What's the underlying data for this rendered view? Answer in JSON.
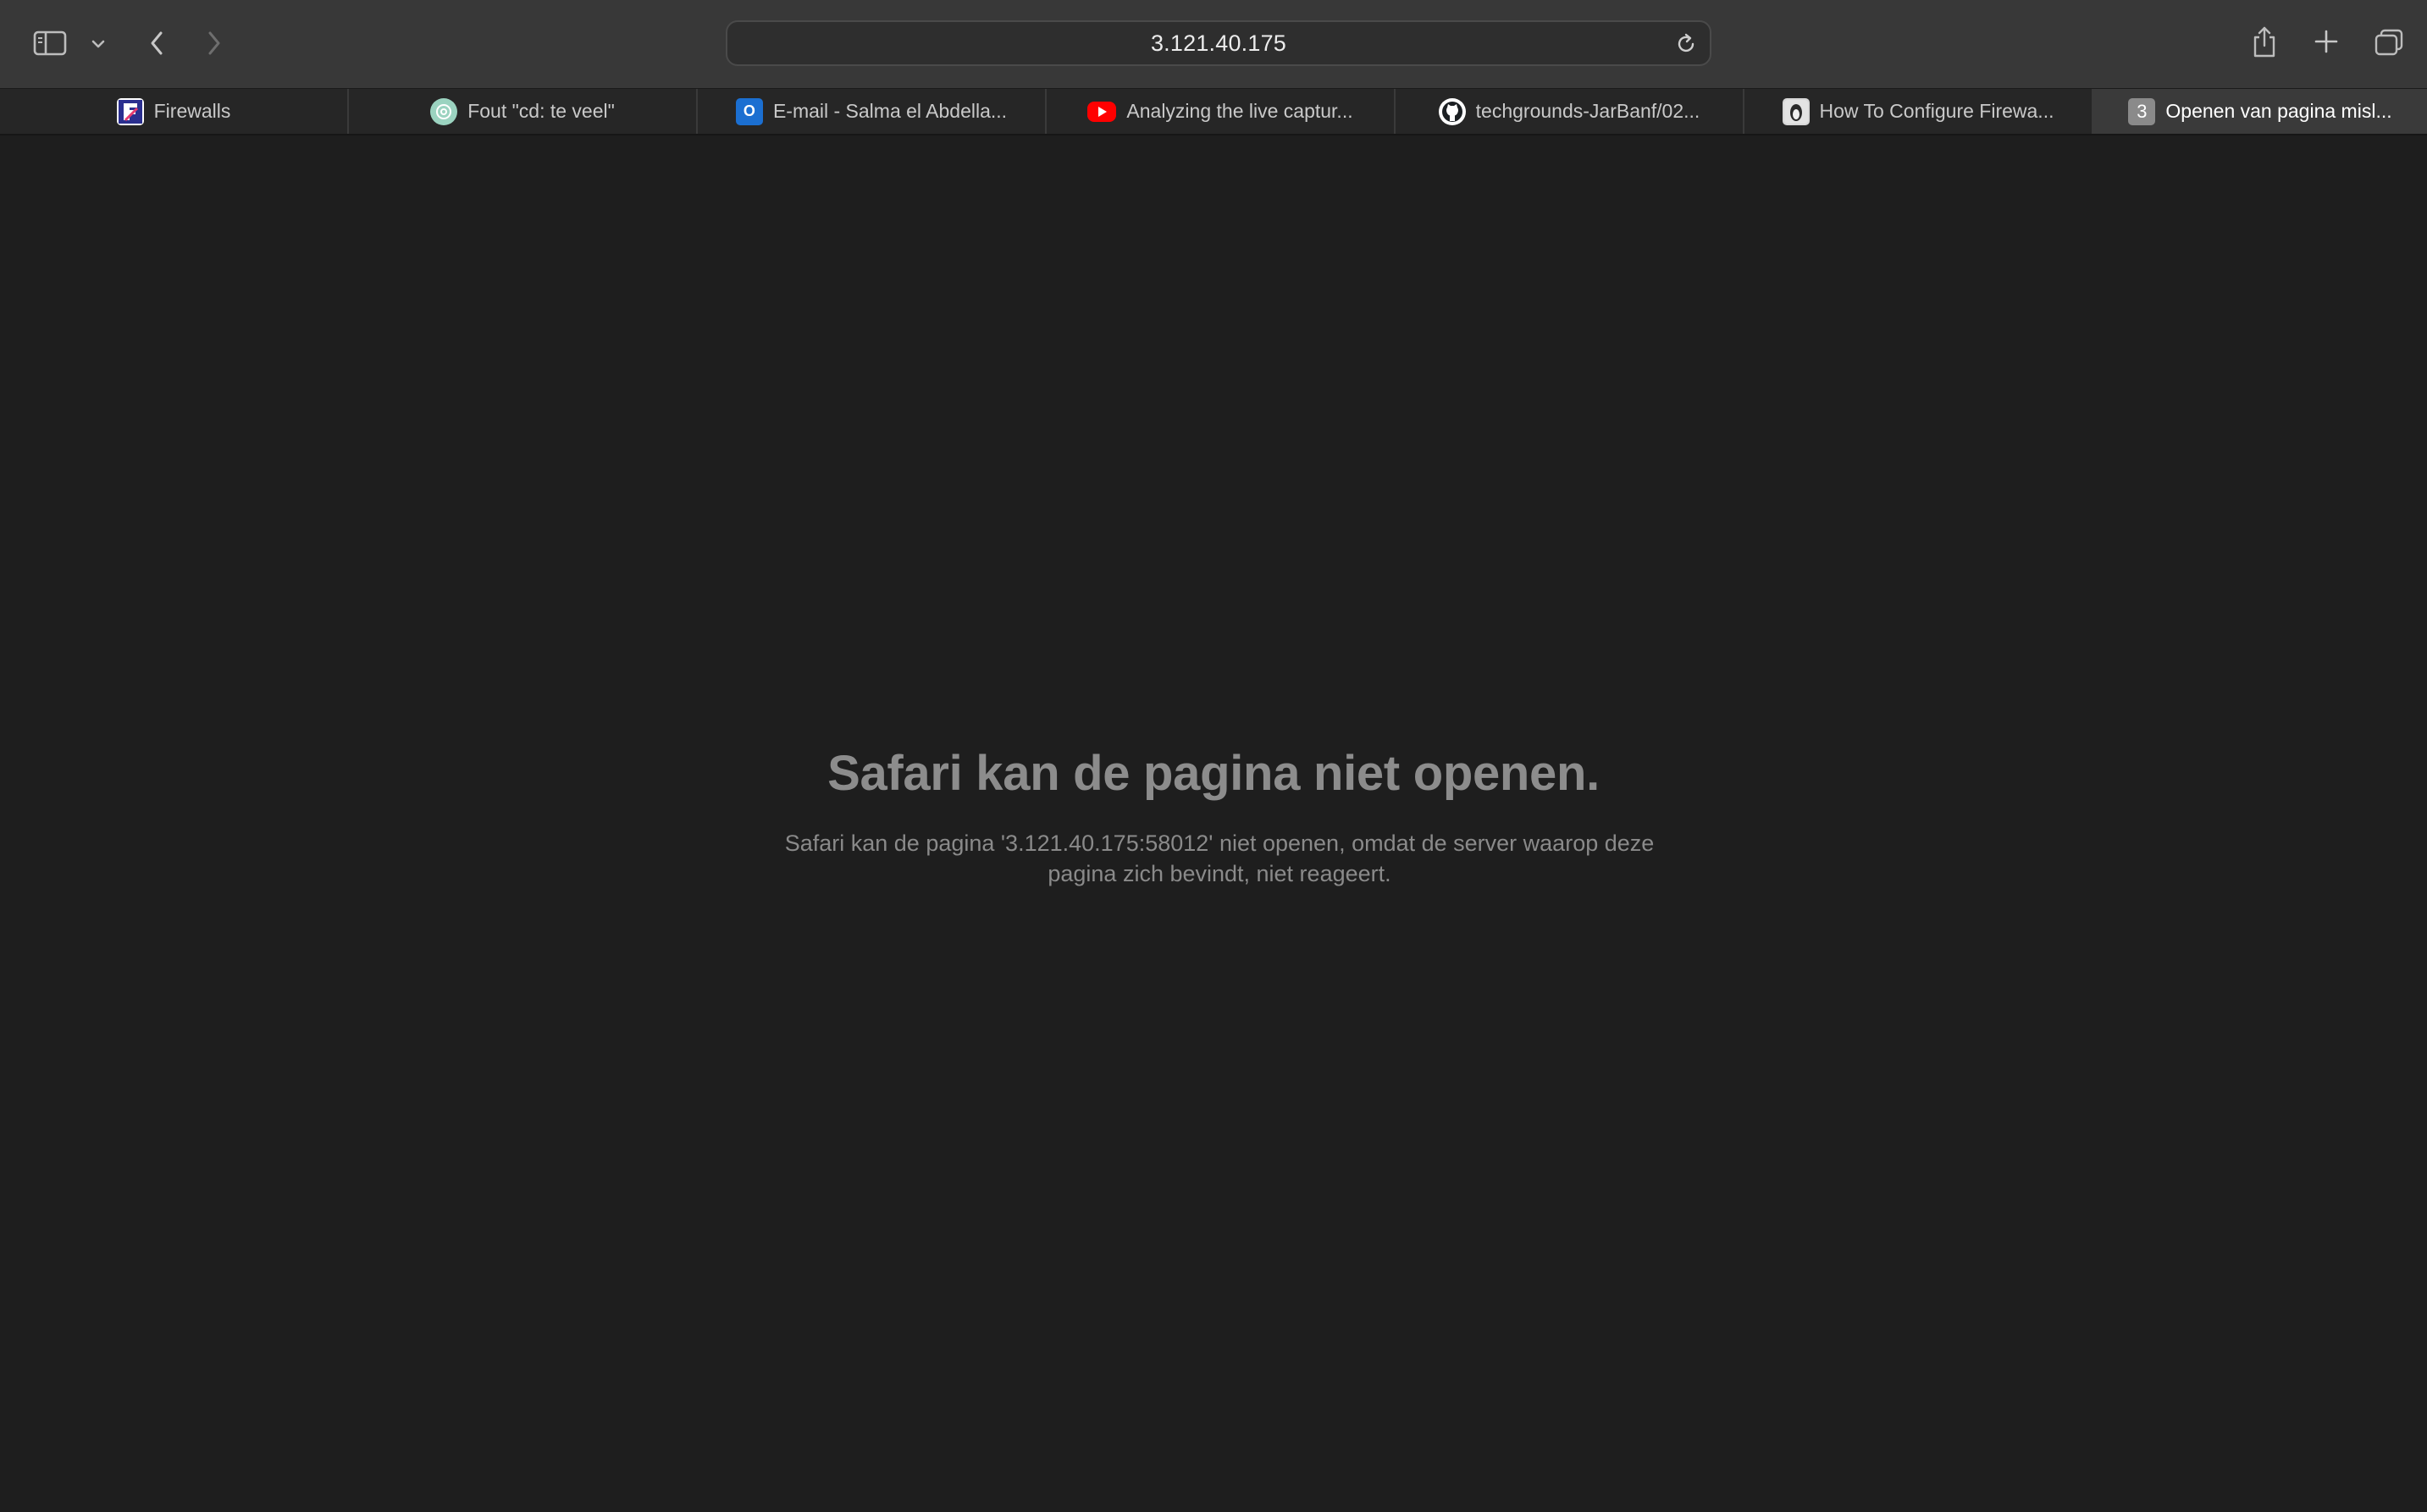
{
  "toolbar": {
    "address": "3.121.40.175"
  },
  "tabs": [
    {
      "label": "Firewalls",
      "icon": "firewalls-favicon"
    },
    {
      "label": "Fout \"cd: te veel\"",
      "icon": "chatgpt-favicon"
    },
    {
      "label": "E-mail - Salma el Abdella...",
      "icon": "outlook-favicon",
      "icon_text": "O"
    },
    {
      "label": "Analyzing the live captur...",
      "icon": "youtube-favicon"
    },
    {
      "label": "techgrounds-JarBanf/02...",
      "icon": "github-favicon"
    },
    {
      "label": "How To Configure Firewa...",
      "icon": "article-favicon"
    },
    {
      "label": "Openen van pagina misl...",
      "icon": "number-favicon",
      "icon_text": "3",
      "active": true
    }
  ],
  "error": {
    "title": "Safari kan de pagina niet openen.",
    "message": "Safari kan de pagina '3.121.40.175:58012' niet openen, omdat de server waarop deze pagina zich bevindt, niet reageert."
  },
  "colors": {
    "toolbar_bg": "#383838",
    "content_bg": "#1e1e1e",
    "active_tab_bg": "#3a3a3a"
  }
}
